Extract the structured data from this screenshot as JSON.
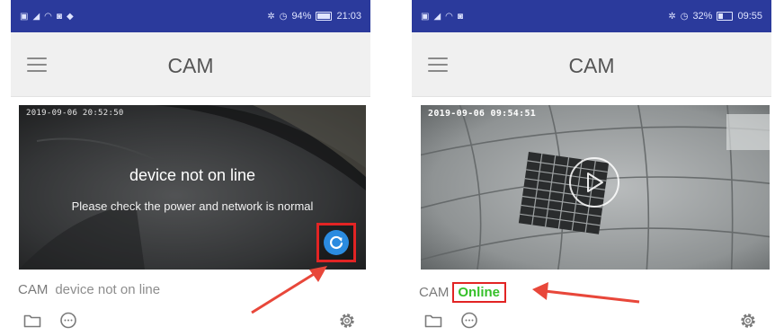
{
  "phones": [
    {
      "status_bar": {
        "battery": "94%",
        "time": "21:03",
        "battery_level": 0.94
      },
      "app_title": "CAM",
      "video": {
        "timestamp": "2019-09-06 20:52:50",
        "overlay_title": "device not on line",
        "overlay_message": "Please check the power and network is normal"
      },
      "device": {
        "name": "CAM",
        "status": "device not on line"
      }
    },
    {
      "status_bar": {
        "battery": "32%",
        "time": "09:55",
        "battery_level": 0.32
      },
      "app_title": "CAM",
      "video": {
        "timestamp": "2019-09-06 09:54:51"
      },
      "device": {
        "name": "CAM",
        "status": "Online"
      }
    }
  ],
  "icons": {
    "menu": "hamburger-icon",
    "refresh": "refresh-icon",
    "play": "play-icon",
    "folder": "folder-icon",
    "chat": "chat-icon",
    "settings": "gear-icon"
  },
  "colors": {
    "status_bar": "#2b3a9c",
    "app_bar": "#f0f0f0",
    "highlight": "#e22424",
    "online": "#36c02a",
    "refresh": "#2b8be0"
  }
}
